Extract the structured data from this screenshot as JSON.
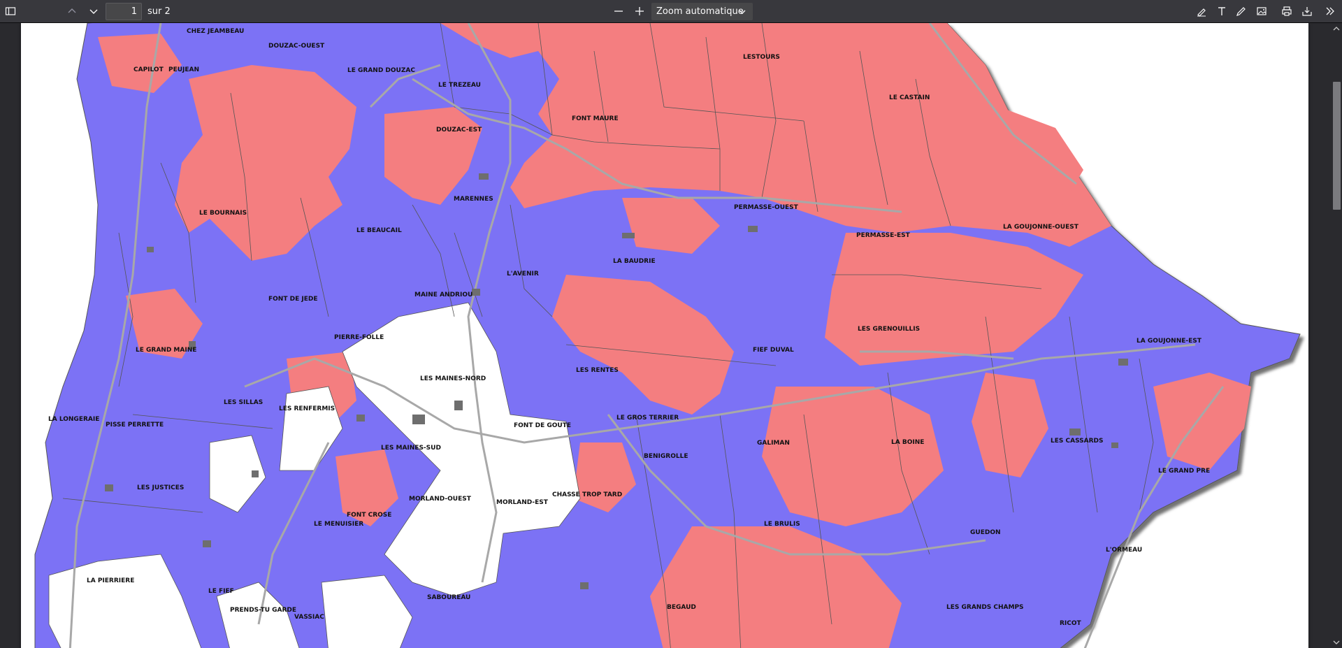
{
  "toolbar": {
    "page_number": "1",
    "page_of": "sur 2",
    "zoom_label": "Zoom automatique"
  },
  "colors": {
    "red_zone": "#f47e80",
    "blue_zone": "#7b72f5",
    "white_zone": "#ffffff",
    "toolbar_bg": "#38383d",
    "viewer_bg": "#2a2a2e"
  },
  "icons": [
    "sidebar-toggle-icon",
    "chevron-up-icon",
    "chevron-down-icon",
    "minus-icon",
    "plus-icon",
    "highlight-pen-icon",
    "text-icon",
    "draw-pen-icon",
    "image-icon",
    "print-icon",
    "download-icon",
    "double-chevron-right-icon"
  ],
  "map": {
    "labels": [
      {
        "id": "chez-jeambeau",
        "text": "CHEZ JEAMBEAU"
      },
      {
        "id": "douzac-ouest",
        "text": "DOUZAC-OUEST"
      },
      {
        "id": "capilot",
        "text": "CAPILOT"
      },
      {
        "id": "peujean",
        "text": "PEUJEAN"
      },
      {
        "id": "le-grand-douzac",
        "text": "LE GRAND DOUZAC"
      },
      {
        "id": "le-trezeau",
        "text": "LE TREZEAU"
      },
      {
        "id": "lestours",
        "text": "LESTOURS"
      },
      {
        "id": "le-castain",
        "text": "LE CASTAIN"
      },
      {
        "id": "font-maure",
        "text": "FONT MAURE"
      },
      {
        "id": "douzac-est",
        "text": "DOUZAC-EST"
      },
      {
        "id": "marennes",
        "text": "MARENNES"
      },
      {
        "id": "le-bournais",
        "text": "LE BOURNAIS"
      },
      {
        "id": "permasse-ouest",
        "text": "PERMASSE-OUEST"
      },
      {
        "id": "le-beaucail",
        "text": "LE BEAUCAIL"
      },
      {
        "id": "permasse-est",
        "text": "PERMASSE-EST"
      },
      {
        "id": "la-goujonne-ouest",
        "text": "LA GOUJONNE-OUEST"
      },
      {
        "id": "la-baudrie",
        "text": "LA BAUDRIE"
      },
      {
        "id": "l-avenir",
        "text": "L'AVENIR"
      },
      {
        "id": "maine-andriou",
        "text": "MAINE ANDRIOU"
      },
      {
        "id": "font-de-jede",
        "text": "FONT DE JEDE"
      },
      {
        "id": "les-grenouillis",
        "text": "LES GRENOUILLIS"
      },
      {
        "id": "pierre-folle",
        "text": "PIERRE-FOLLE"
      },
      {
        "id": "la-goujonne-est",
        "text": "LA GOUJONNE-EST"
      },
      {
        "id": "le-grand-maine",
        "text": "LE GRAND MAINE"
      },
      {
        "id": "fief-duval",
        "text": "FIEF DUVAL"
      },
      {
        "id": "les-rentes",
        "text": "LES RENTES"
      },
      {
        "id": "les-maines-nord",
        "text": "LES MAINES-NORD"
      },
      {
        "id": "les-sillas",
        "text": "LES SILLAS"
      },
      {
        "id": "les-renfermis",
        "text": "LES RENFERMIS"
      },
      {
        "id": "la-longeraie",
        "text": "LA LONGERAIE"
      },
      {
        "id": "le-gros-terrier",
        "text": "LE GROS TERRIER"
      },
      {
        "id": "pisse-perrette",
        "text": "PISSE PERRETTE"
      },
      {
        "id": "font-de-goute",
        "text": "FONT DE GOUTE"
      },
      {
        "id": "la-boine",
        "text": "LA BOINE"
      },
      {
        "id": "les-cassards",
        "text": "LES CASSARDS"
      },
      {
        "id": "galiman",
        "text": "GALIMAN"
      },
      {
        "id": "les-maines-sud",
        "text": "LES MAINES-SUD"
      },
      {
        "id": "benigrolle",
        "text": "BENIGROLLE"
      },
      {
        "id": "le-grand-pre",
        "text": "LE GRAND PRE"
      },
      {
        "id": "les-justices",
        "text": "LES JUSTICES"
      },
      {
        "id": "chasse-trop-tard",
        "text": "CHASSE TROP TARD"
      },
      {
        "id": "morland-ouest",
        "text": "MORLAND-OUEST"
      },
      {
        "id": "morland-est",
        "text": "MORLAND-EST"
      },
      {
        "id": "font-crose",
        "text": "FONT CROSE"
      },
      {
        "id": "le-menuisier",
        "text": "LE MENUISIER"
      },
      {
        "id": "le-brulis",
        "text": "LE BRULIS"
      },
      {
        "id": "guedon",
        "text": "GUEDON"
      },
      {
        "id": "l-ormeau",
        "text": "L'ORMEAU"
      },
      {
        "id": "la-pierriere",
        "text": "LA PIERRIERE"
      },
      {
        "id": "le-fief",
        "text": "LE FIEF"
      },
      {
        "id": "saboureau",
        "text": "SABOUREAU"
      },
      {
        "id": "begaud",
        "text": "BEGAUD"
      },
      {
        "id": "les-grands-champs",
        "text": "LES GRANDS CHAMPS"
      },
      {
        "id": "prends-tu-garde",
        "text": "PRENDS-TU GARDE"
      },
      {
        "id": "vassiac",
        "text": "VASSIAC"
      },
      {
        "id": "ricot",
        "text": "RICOT"
      }
    ]
  }
}
